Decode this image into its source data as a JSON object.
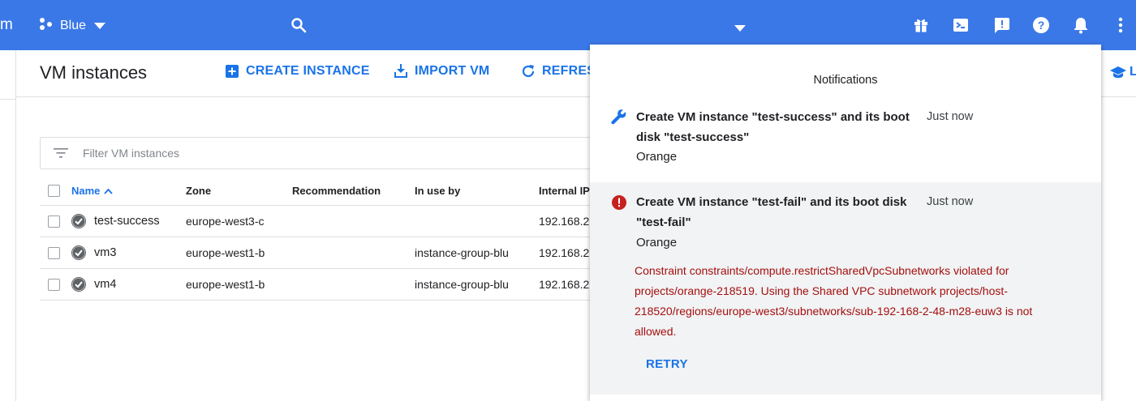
{
  "header": {
    "brand_fragment": "m",
    "project_name": "Blue"
  },
  "page": {
    "title": "VM instances",
    "actions": {
      "create": "CREATE INSTANCE",
      "import": "IMPORT VM",
      "refresh": "REFRESH",
      "learn": "L"
    }
  },
  "filter": {
    "placeholder": "Filter VM instances"
  },
  "table": {
    "columns": {
      "name": "Name",
      "zone": "Zone",
      "recommendation": "Recommendation",
      "in_use_by": "In use by",
      "internal_ip": "Internal IP"
    },
    "rows": [
      {
        "name": "test-success",
        "zone": "europe-west3-c",
        "recommendation": "",
        "in_use_by": "",
        "internal_ip": "192.168.2"
      },
      {
        "name": "vm3",
        "zone": "europe-west1-b",
        "recommendation": "",
        "in_use_by": "instance-group-blu",
        "internal_ip": "192.168.2"
      },
      {
        "name": "vm4",
        "zone": "europe-west1-b",
        "recommendation": "",
        "in_use_by": "instance-group-blu",
        "internal_ip": "192.168.2"
      }
    ]
  },
  "notifications": {
    "title": "Notifications",
    "items": [
      {
        "icon": "wrench-icon",
        "text": "Create VM instance \"test-success\" and its boot disk \"test-success\"",
        "time": "Just now",
        "project": "Orange"
      },
      {
        "icon": "error-icon",
        "text": "Create VM instance \"test-fail\" and its boot disk \"test-fail\"",
        "time": "Just now",
        "project": "Orange",
        "error": "Constraint constraints/compute.restrictSharedVpcSubnetworks violated for projects/orange-218519. Using the Shared VPC subnetwork projects/host-218520/regions/europe-west3/subnetworks/sub-192-168-2-48-m28-euw3 is not allowed.",
        "retry": "RETRY"
      }
    ]
  },
  "colors": {
    "topbar": "#3b78e7",
    "accent": "#1a73e8",
    "error": "#a50e0e"
  }
}
